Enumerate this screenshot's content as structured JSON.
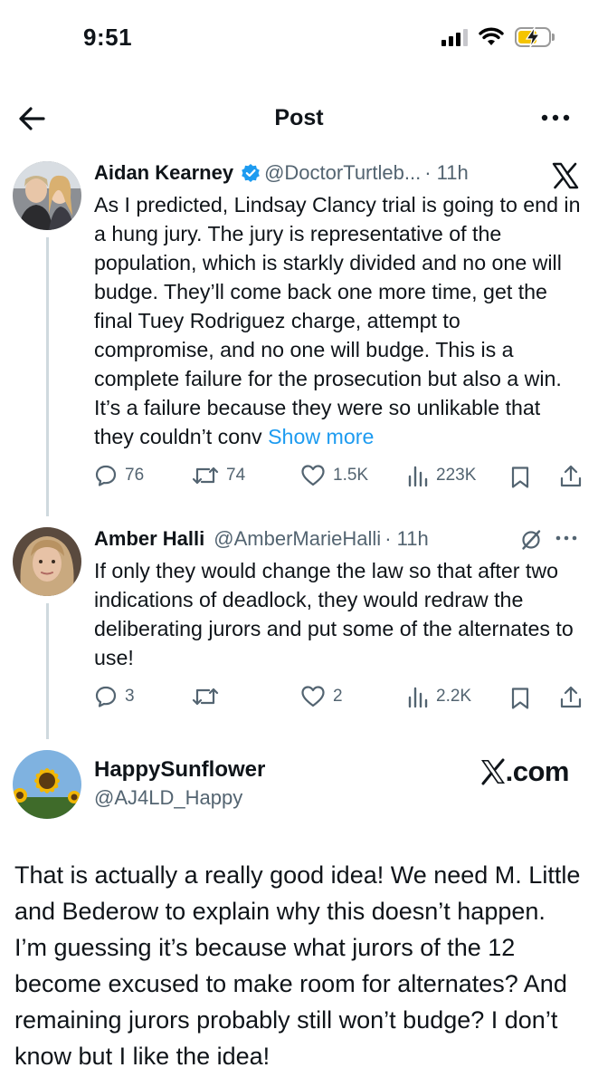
{
  "status_bar": {
    "time": "9:51"
  },
  "header": {
    "title": "Post"
  },
  "tweets": [
    {
      "author": "Aidan Kearney",
      "handle": "@DoctorTurtleb...",
      "time": "· 11h",
      "text": "As I predicted, Lindsay Clancy trial is going to end in a hung jury. The jury is representative of the population, which is starkly divided and no one will budge. They’ll come back one more time, get the final Tuey Rodriguez charge, attempt to compromise, and no one will budge. This is a complete failure for the prosecution but also a win. It’s a failure because they were so unlikable that they couldn’t conv",
      "show_more": "Show more",
      "replies": "76",
      "reposts": "74",
      "likes": "1.5K",
      "views": "223K"
    },
    {
      "author": "Amber Halli",
      "handle": "@AmberMarieHalli",
      "time": "· 11h",
      "text": "If only they would change the law so that after two indications of deadlock, they would redraw the deliberating jurors and put some of the alternates to use!",
      "replies": "3",
      "reposts": "",
      "likes": "2",
      "views": "2.2K"
    }
  ],
  "comment": {
    "author": "HappySunflower",
    "handle": "@AJ4LD_Happy",
    "source": ".com",
    "text": "That is actually a really good idea! We need M. Little and Bederow to explain why this doesn’t happen. I’m guessing it’s because what jurors of the 12 become excused to make room for alternates? And remaining jurors probably still won’t budge? I don’t know but I like the idea!"
  },
  "colors": {
    "link": "#1d9bf0",
    "muted": "#536471",
    "verified": "#1d9bf0",
    "text": "#0f1419"
  }
}
